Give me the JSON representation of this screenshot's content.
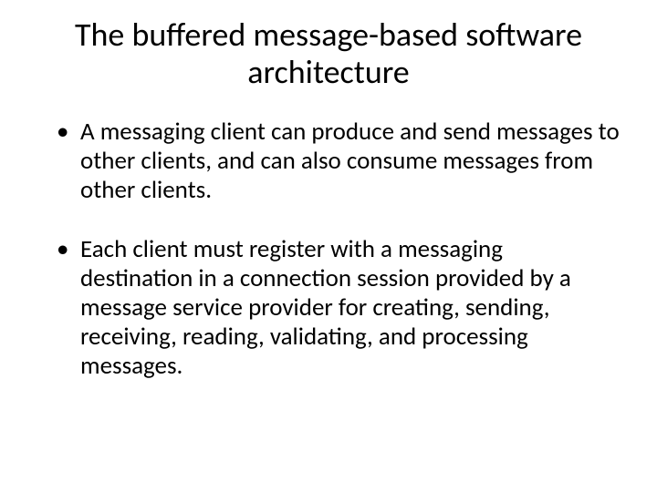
{
  "slide": {
    "title": "The buffered message-based software architecture",
    "bullets": [
      "A messaging client can produce and send messages to other clients, and can also consume messages from other clients.",
      "Each client must register with a messaging destination in a connection session provided by a message service provider for creating, sending, receiving, reading, validating, and processing messages."
    ]
  }
}
